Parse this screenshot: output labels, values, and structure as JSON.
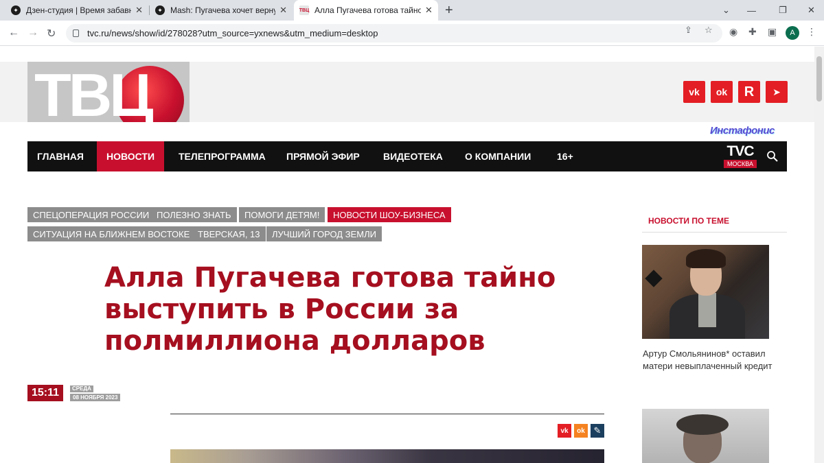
{
  "browser": {
    "tabs": [
      {
        "title": "Дзен-студия | Время забавных",
        "active": false
      },
      {
        "title": "Mash: Пугачева хочет вернуться",
        "active": false
      },
      {
        "title": "Алла Пугачева готова тайно вы",
        "active": true
      }
    ],
    "new_tab_label": "+",
    "window_controls": {
      "dropdown": "⌄",
      "minimize": "—",
      "restore": "❐",
      "close": "✕"
    },
    "url": "tvc.ru/news/show/id/278028?utm_source=yxnews&utm_medium=desktop",
    "profile_initial": "A"
  },
  "site": {
    "logo_text": "ТВЦ",
    "social": [
      {
        "name": "vk",
        "label": "vk"
      },
      {
        "name": "ok",
        "label": "ok"
      },
      {
        "name": "rutube",
        "label": "R"
      },
      {
        "name": "telegram",
        "label": "➤"
      }
    ],
    "promo_text": "Инстафонис",
    "nav": [
      {
        "label": "ГЛАВНАЯ",
        "active": false
      },
      {
        "label": "НОВОСТИ",
        "active": true
      },
      {
        "label": "ТЕЛЕПРОГРАММА",
        "active": false
      },
      {
        "label": "ПРЯМОЙ ЭФИР",
        "active": false
      },
      {
        "label": "ВИДЕОТЕКА",
        "active": false
      },
      {
        "label": "О КОМПАНИИ",
        "active": false
      },
      {
        "label": "16+",
        "active": false
      }
    ],
    "tvc_logo": {
      "top": "TVC",
      "bottom": "МОСКВА"
    }
  },
  "tags": [
    {
      "label": "СПЕЦОПЕРАЦИЯ РОССИИ",
      "active": false
    },
    {
      "label": "ПОЛЕЗНО ЗНАТЬ",
      "active": false
    },
    {
      "label": "ПОМОГИ ДЕТЯМ!",
      "active": false
    },
    {
      "label": "НОВОСТИ ШОУ-БИЗНЕСА",
      "active": true
    },
    {
      "label": "СИТУАЦИЯ НА БЛИЖНЕМ ВОСТОКЕ",
      "active": false
    },
    {
      "label": "ТВЕРСКАЯ, 13",
      "active": false
    },
    {
      "label": "ЛУЧШИЙ ГОРОД ЗЕМЛИ",
      "active": false
    }
  ],
  "article": {
    "headline": "Алла Пугачева готова тайно выступить в России за полмиллиона долларов",
    "time": "15:11",
    "day": "СРЕДА",
    "date": "08 НОЯБРЯ 2023",
    "share": [
      {
        "name": "vk",
        "label": "vk",
        "color": "#e31e24"
      },
      {
        "name": "ok",
        "label": "ok",
        "color": "#f58220"
      },
      {
        "name": "edit",
        "label": "✎",
        "color": "#1b3f5e"
      }
    ]
  },
  "sidebar": {
    "title": "НОВОСТИ ПО ТЕМЕ",
    "items": [
      {
        "caption": "Артур Смольянинов* оставил матери невыплаченный кредит"
      }
    ]
  },
  "colors": {
    "brand_red": "#c8102e",
    "headline_red": "#a50f1f",
    "nav_bg": "#111111",
    "tag_gray": "#8c8c8c"
  }
}
